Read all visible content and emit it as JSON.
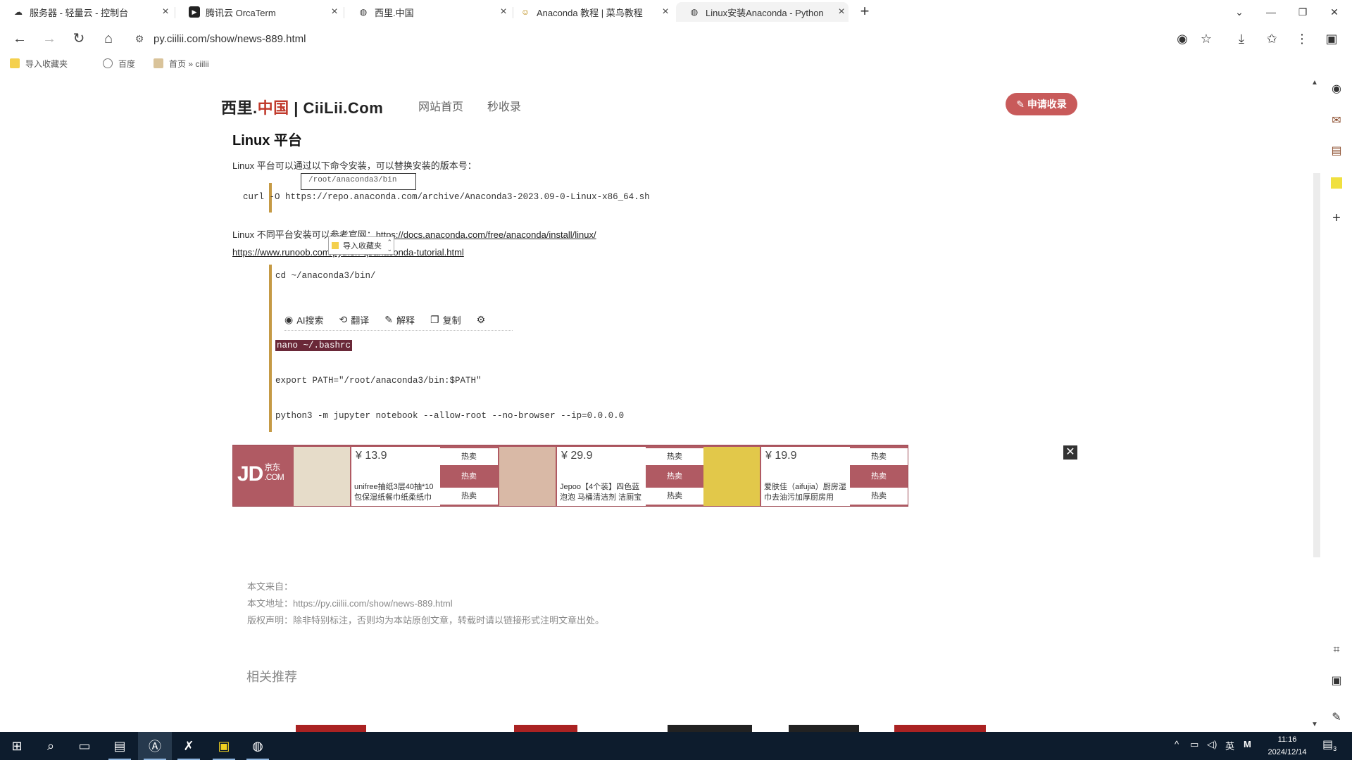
{
  "tabs": [
    {
      "label": "服务器 - 轻量云 - 控制台",
      "icon": "cloud-icon"
    },
    {
      "label": "腾讯云 OrcaTerm",
      "icon": "terminal-icon"
    },
    {
      "label": "西里.中国",
      "icon": "globe-icon"
    },
    {
      "label": "Anaconda 教程 | 菜鸟教程",
      "icon": "runoob-icon"
    },
    {
      "label": "Linux安装Anaconda - Python",
      "icon": "globe-icon"
    }
  ],
  "toolbar": {
    "url": "py.ciilii.com/show/news-889.html"
  },
  "bookmarks": [
    {
      "label": "导入收藏夹"
    },
    {
      "label": "百度"
    },
    {
      "label": "首页 » ciilii"
    }
  ],
  "site": {
    "logo_black1": "西里.",
    "logo_red": "中国",
    "logo_black2": " | CiiLii.Com",
    "nav_home": "网站首页",
    "nav_fast": "秒收录",
    "apply_label": "申请收录"
  },
  "article": {
    "heading": "Linux 平台",
    "intro": "Linux 平台可以通过以下命令安装，可以替换安装的版本号：",
    "tooltip": "/root/anaconda3/bin",
    "curl_cmd": "curl -O https://repo.anaconda.com/archive/Anaconda3-2023.09-0-Linux-x86_64.sh",
    "ref_prefix": "Linux 不同平台安装可以参考官网：",
    "ref_link": "https://docs.anaconda.com/free/anaconda/install/linux/",
    "runoob_link": "https://www.runoob.com/python-qt/anaconda-tutorial.html",
    "popup_label": "导入收藏夹",
    "cmd_cd": "cd ~/anaconda3/bin/",
    "cmd_nano": "nano ~/.bashrc",
    "cmd_export": "export PATH=\"/root/anaconda3/bin:$PATH\"",
    "cmd_jupyter": "python3 -m jupyter notebook --allow-root --no-browser --ip=0.0.0.0"
  },
  "selection_toolbar": {
    "ai_search": "AI搜索",
    "translate": "翻译",
    "explain": "解释",
    "copy": "复制"
  },
  "ad": {
    "jd_logo": "JD",
    "jd_small": "京东",
    "jd_com": ".COM",
    "hot_label": "热卖",
    "products": [
      {
        "price": "¥ 13.9",
        "name": "unifree抽纸3层40抽*10包保湿纸餐巾纸柔纸巾"
      },
      {
        "price": "¥ 29.9",
        "name": "Jepoo【4个装】四色蓝泡泡 马桶清洁剂 洁厕宝"
      },
      {
        "price": "¥ 19.9",
        "name": "爱肤佳（aifujia）厨房湿巾去油污加厚厨房用"
      }
    ]
  },
  "footer": {
    "source_label": "本文来自：",
    "address": "本文地址：https://py.ciilii.com/show/news-889.html",
    "copyright": "版权声明：除非特别标注，否则均为本站原创文章，转载时请以链接形式注明文章出处。",
    "related": "相关推荐"
  },
  "taskbar": {
    "ime": "英",
    "clock_time": "11:16",
    "clock_date": "2024/12/14",
    "notif_count": "3"
  },
  "colors": {
    "accent_red": "#c0392b",
    "apply_button": "#c85a5a",
    "ad_bg": "#b05a63",
    "code_bar": "#c59a45",
    "taskbar": "#0d1c2d"
  }
}
